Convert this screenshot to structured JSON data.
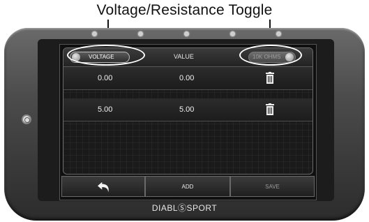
{
  "caption": "Voltage/Resistance Toggle",
  "brand": "DIABLⓈSPORT",
  "header": {
    "voltage_toggle_label": "VOLTAGE",
    "value_label": "VALUE",
    "resistance_toggle_label": "10K OHMS"
  },
  "rows": [
    {
      "voltage": "0.00",
      "value": "0.00"
    },
    {
      "voltage": "5.00",
      "value": "5.00"
    }
  ],
  "buttons": {
    "back": "back-arrow-icon",
    "add": "ADD",
    "save": "SAVE"
  }
}
